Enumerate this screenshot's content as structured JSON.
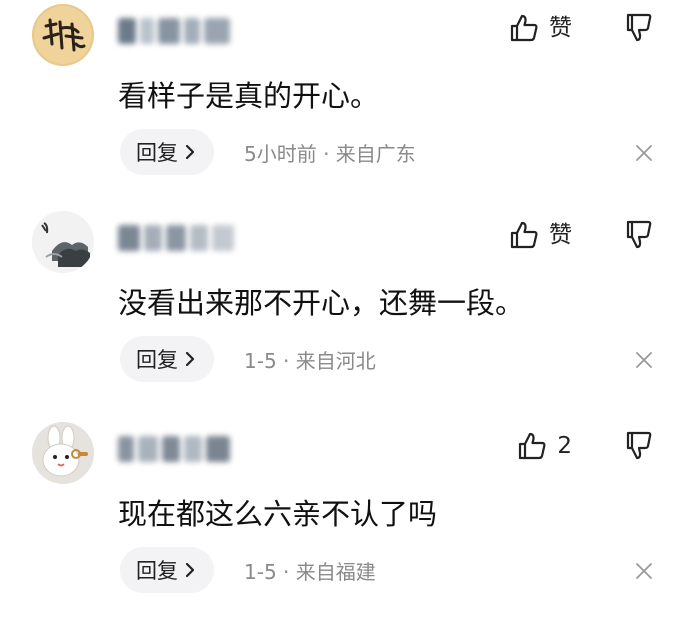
{
  "comments": [
    {
      "content": "看样子是真的开心。",
      "like_label": "赞",
      "reply_label": "回复",
      "meta": "5小时前 · 来自广东",
      "avatar_icon": "calligraphy-avatar",
      "like_icon": "thumbs-up-icon",
      "dislike_icon": "thumbs-down-icon",
      "close_icon": "close-icon"
    },
    {
      "content": "没看出来那不开心，还舞一段。",
      "like_label": "赞",
      "reply_label": "回复",
      "meta": "1-5 · 来自河北",
      "avatar_icon": "ink-painting-avatar",
      "like_icon": "thumbs-up-icon",
      "dislike_icon": "thumbs-down-icon",
      "close_icon": "close-icon"
    },
    {
      "content": "现在都这么六亲不认了吗",
      "like_label": "2",
      "reply_label": "回复",
      "meta": "1-5 · 来自福建",
      "avatar_icon": "white-rabbit-avatar",
      "like_icon": "thumbs-up-icon",
      "dislike_icon": "thumbs-down-icon",
      "close_icon": "close-icon"
    }
  ],
  "colors": {
    "text": "#111111",
    "meta": "#8a8a8a",
    "reply_bg": "#f3f3f5",
    "icon": "#222222"
  }
}
